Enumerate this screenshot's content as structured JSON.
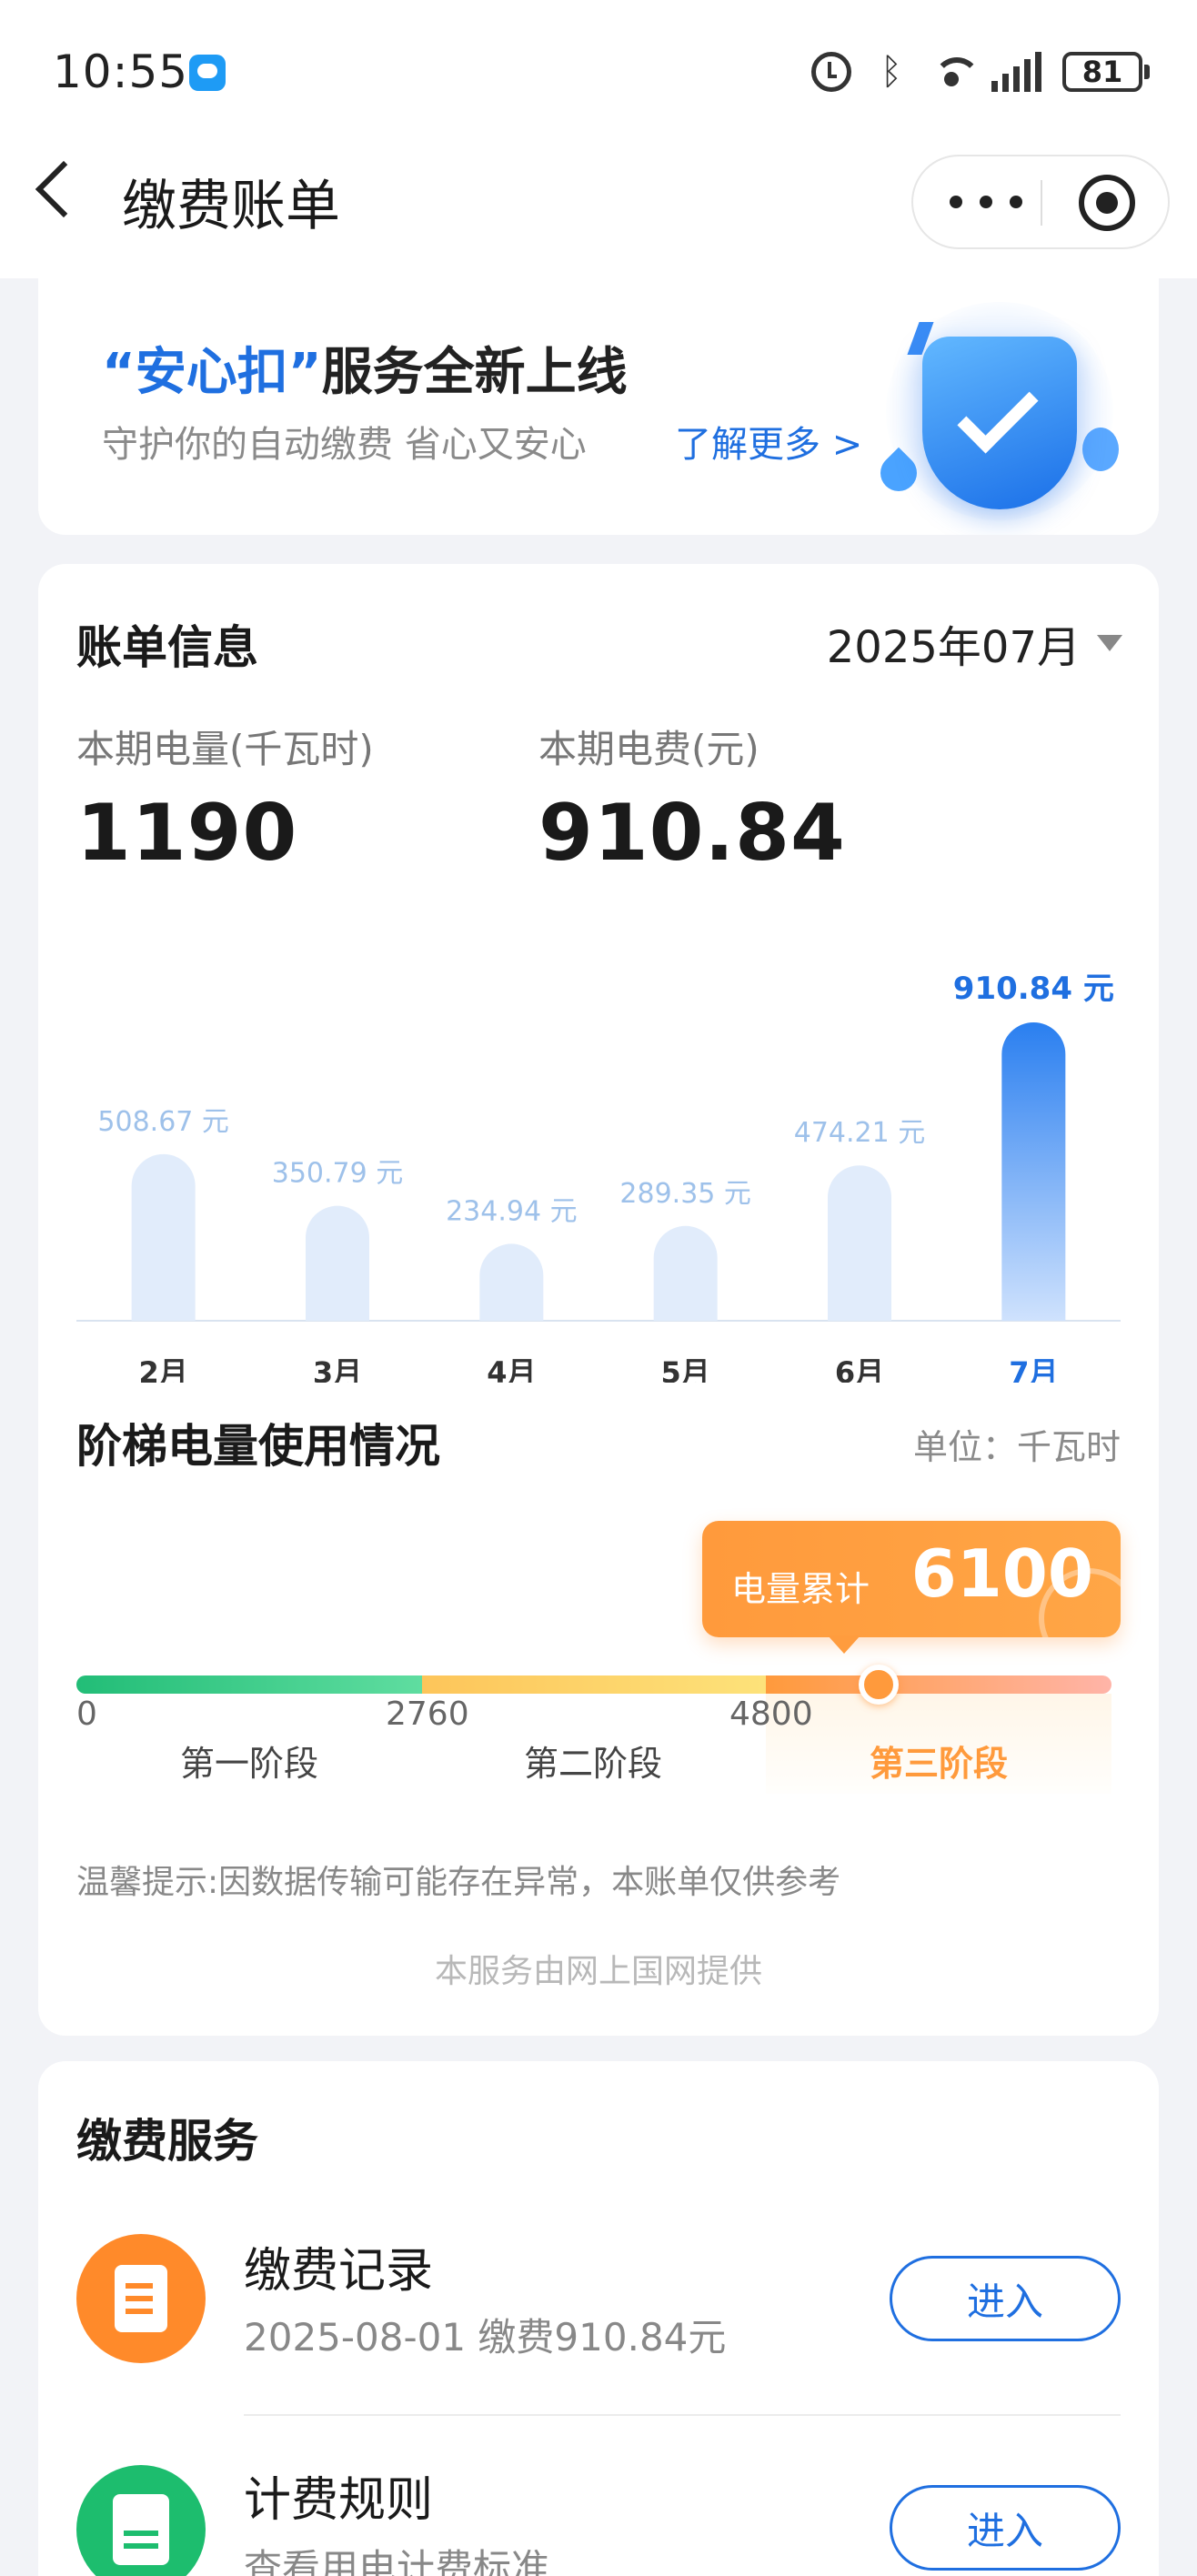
{
  "status_bar": {
    "time": "10:55",
    "battery": "81"
  },
  "nav": {
    "title": "缴费账单"
  },
  "banner": {
    "title_highlight": "“安心扣”",
    "title_rest": "服务全新上线",
    "subtitle": "守护你的自动缴费 省心又安心",
    "link": "了解更多 >"
  },
  "bill": {
    "title": "账单信息",
    "month": "2025年07月",
    "usage_label": "本期电量(千瓦时)",
    "usage_value": "1190",
    "fee_label": "本期电费(元)",
    "fee_value": "910.84"
  },
  "chart_data": {
    "type": "bar",
    "categories": [
      "2月",
      "3月",
      "4月",
      "5月",
      "6月",
      "7月"
    ],
    "values": [
      508.67,
      350.79,
      234.94,
      289.35,
      474.21,
      910.84
    ],
    "labels": [
      "508.67 元",
      "350.79 元",
      "234.94 元",
      "289.35 元",
      "474.21 元",
      "910.84 元"
    ],
    "highlight_index": 5,
    "colors": {
      "bar": "#e1ecfb",
      "highlight_top": "#2a7ff0",
      "highlight_bottom": "#cfe2fd",
      "label": "#9ec1ea",
      "highlight_label": "#1f6fe0"
    },
    "ylim": [
      0,
      910.84
    ]
  },
  "tier": {
    "title": "阶梯电量使用情况",
    "unit": "单位：千瓦时",
    "tooltip_label": "电量累计",
    "tooltip_value": "6100",
    "ticks": [
      "0",
      "2760",
      "4800"
    ],
    "stages": [
      "第一阶段",
      "第二阶段",
      "第三阶段"
    ],
    "current_stage": 2
  },
  "tip": "温馨提示:因数据传输可能存在异常，本账单仅供参考",
  "provider": "本服务由网上国网提供",
  "services": {
    "title": "缴费服务",
    "items": [
      {
        "name": "缴费记录",
        "desc": "2025-08-01 缴费910.84元",
        "button": "进入"
      },
      {
        "name": "计费规则",
        "desc": "查看用电计费标准",
        "button": "进入"
      }
    ]
  }
}
